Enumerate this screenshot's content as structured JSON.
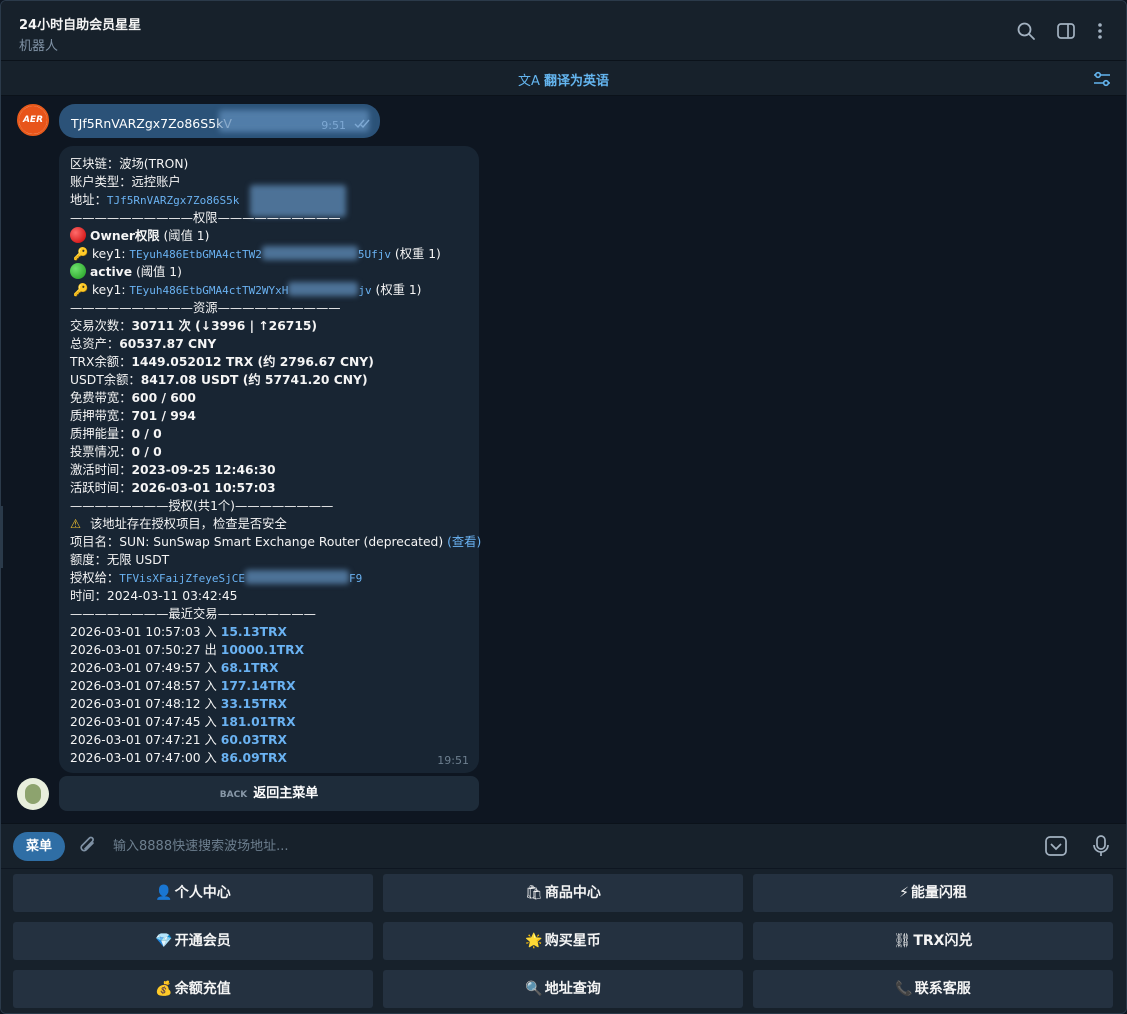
{
  "header": {
    "title": "24小时自助会员星星",
    "subtitle": "机器人"
  },
  "translate": {
    "label": "翻译为英语",
    "icon": "文A"
  },
  "outgoing": {
    "avatar_text": "AER",
    "text": "TJf5RnVARZgx7Zo86S5kV",
    "time": "9:51"
  },
  "incoming": {
    "time": "19:51",
    "lines": {
      "chain": "区块链：波场(TRON)",
      "account_type": "账户类型：远控账户",
      "address_label": "地址：",
      "address_value": "TJf5RnVARZgx7Zo86S5k",
      "sep_permissions": "——————————权限——————————",
      "owner_title": "Owner权限",
      "owner_threshold": " (阈值 1)",
      "key1_label": "key1:",
      "owner_key_a": "TEyuh486EtbGMA4ctTW2",
      "owner_key_b": "5Ufjv",
      "weight": " (权重 1)",
      "active_title": "active",
      "active_threshold": " (阈值 1)",
      "active_key_a": "TEyuh486EtbGMA4ctTW2WYxH",
      "active_key_b": "jv",
      "sep_resources": "——————————资源——————————",
      "tx_count_label": "交易次数：",
      "tx_count_value": "30711 次 (↓3996 | ↑26715)",
      "total_assets_label": "总资产：",
      "total_assets_value": "60537.87 CNY",
      "trx_balance_label": "TRX余额：",
      "trx_balance_value": "1449.052012 TRX (约 2796.67 CNY)",
      "usdt_balance_label": "USDT余额：",
      "usdt_balance_value": "8417.08 USDT (约 57741.20 CNY)",
      "free_bw_label": "免费带宽：",
      "free_bw_value": "600 / 600",
      "staked_bw_label": "质押带宽：",
      "staked_bw_value": "701 / 994",
      "staked_energy_label": "质押能量：",
      "staked_energy_value": "0 / 0",
      "votes_label": "投票情况：",
      "votes_value": "0 / 0",
      "activated_label": "激活时间：",
      "activated_value": "2023-09-25 12:46:30",
      "active_time_label": "活跃时间：",
      "active_time_value": "2026-03-01 10:57:03",
      "sep_auth": "————————授权(共1个)————————",
      "warning": "该地址存在授权项目，检查是否安全",
      "project_label": "项目名：",
      "project_value": "SUN: SunSwap Smart Exchange Router (deprecated)",
      "project_link": "(查看)",
      "quota": "额度：无限 USDT",
      "auth_to_label": "授权给：",
      "auth_to_a": "TFVisXFaijZfeyeSjCE",
      "auth_to_b": "F9",
      "auth_time": "时间：2024-03-11 03:42:45",
      "sep_recent": "————————最近交易————————"
    },
    "transactions": [
      {
        "time": "2026-03-01 10:57:03",
        "dir": "入",
        "amount": "15.13TRX"
      },
      {
        "time": "2026-03-01 07:50:27",
        "dir": "出",
        "amount": "10000.1TRX"
      },
      {
        "time": "2026-03-01 07:49:57",
        "dir": "入",
        "amount": "68.1TRX"
      },
      {
        "time": "2026-03-01 07:48:57",
        "dir": "入",
        "amount": "177.14TRX"
      },
      {
        "time": "2026-03-01 07:48:12",
        "dir": "入",
        "amount": "33.15TRX"
      },
      {
        "time": "2026-03-01 07:47:45",
        "dir": "入",
        "amount": "181.01TRX"
      },
      {
        "time": "2026-03-01 07:47:21",
        "dir": "入",
        "amount": "60.03TRX"
      },
      {
        "time": "2026-03-01 07:47:00",
        "dir": "入",
        "amount": "86.09TRX"
      }
    ]
  },
  "inline_keyboard": {
    "back_icon": "BACK",
    "label": "返回主菜单"
  },
  "input": {
    "menu_label": "菜单",
    "placeholder": "输入8888快速搜索波场地址..."
  },
  "reply_keyboard": [
    {
      "emoji": "👤",
      "label": "个人中心"
    },
    {
      "emoji": "🛍",
      "label": "商品中心"
    },
    {
      "emoji": "⚡",
      "label": "能量闪租"
    },
    {
      "emoji": "💎",
      "label": "开通会员"
    },
    {
      "emoji": "🌟",
      "label": "购买星币"
    },
    {
      "emoji": "⛓",
      "label": "TRX闪兑"
    },
    {
      "emoji": "💰",
      "label": "余额充值"
    },
    {
      "emoji": "🔍",
      "label": "地址查询"
    },
    {
      "emoji": "📞",
      "label": "联系客服"
    }
  ],
  "colors": {
    "background": "#0e1621",
    "panel": "#17212b",
    "outgoing_bubble": "#2b5278",
    "incoming_bubble": "#182533",
    "link": "#6ab2f2",
    "accent_button": "#2f6ea5"
  },
  "icons": {
    "search": "search-icon",
    "sidebar": "sidebar-toggle-icon",
    "more": "more-vertical-icon",
    "filter": "filter-settings-icon",
    "attach": "paperclip-icon",
    "keyboard": "keyboard-toggle-icon",
    "mic": "microphone-icon"
  }
}
